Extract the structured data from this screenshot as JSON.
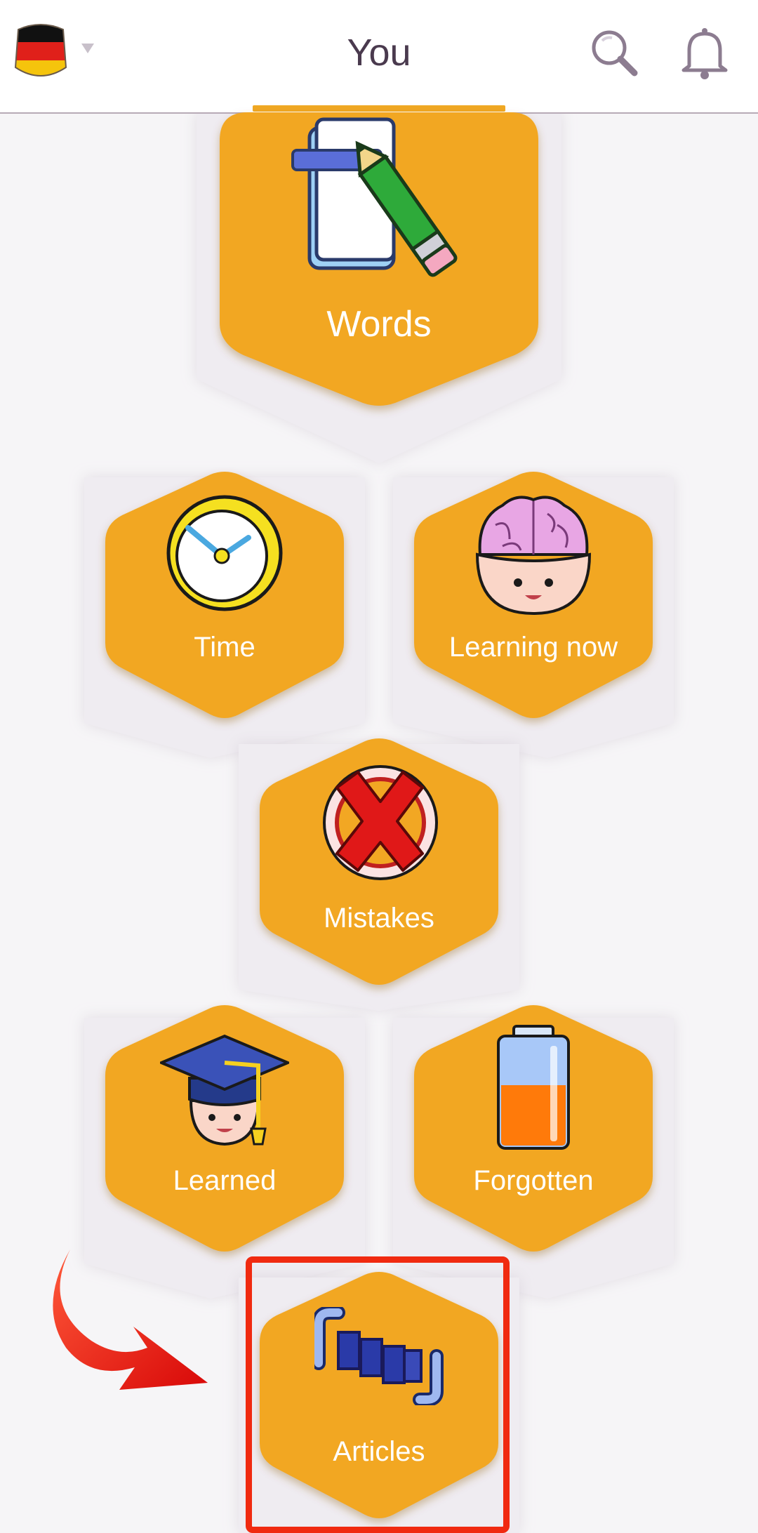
{
  "header": {
    "title": "You",
    "flag_icon": "germany-flag-icon",
    "search_icon": "search-icon",
    "notifications_icon": "bell-icon"
  },
  "tiles": [
    {
      "label": "Words",
      "icon": "notebook-pencil-icon"
    },
    {
      "label": "Time",
      "icon": "clock-icon"
    },
    {
      "label": "Learning now",
      "icon": "brain-icon"
    },
    {
      "label": "Mistakes",
      "icon": "red-x-icon"
    },
    {
      "label": "Learned",
      "icon": "graduation-cap-icon"
    },
    {
      "label": "Forgotten",
      "icon": "battery-icon"
    },
    {
      "label": "Articles",
      "icon": "articles-icon"
    }
  ],
  "colors": {
    "tile": "#f2a723",
    "accent": "#f0a823",
    "highlight": "#f02a10",
    "background": "#f6f5f7"
  }
}
